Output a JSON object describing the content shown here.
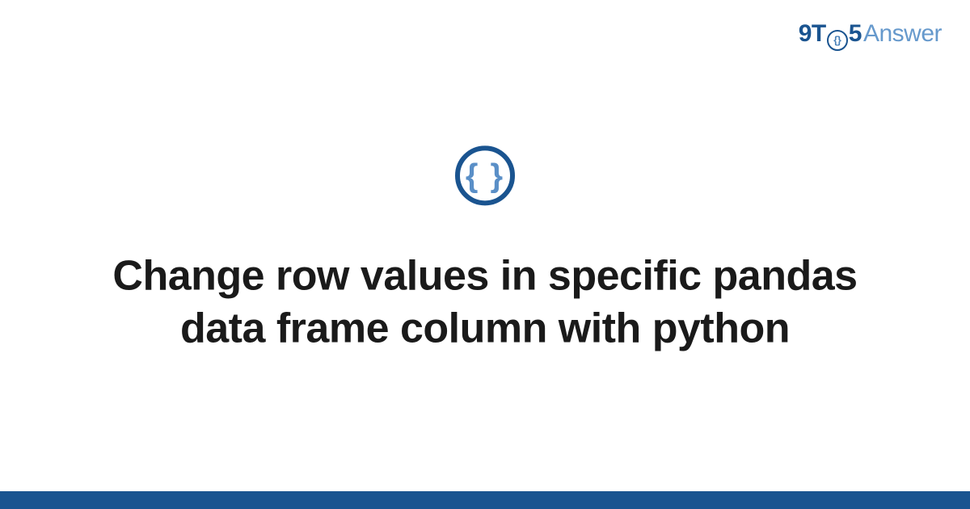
{
  "header": {
    "logo": {
      "part1": "9T",
      "zero_inner": "{}",
      "part2": "5",
      "part3": "Answer"
    }
  },
  "main": {
    "icon_glyph": "{ }",
    "title": "Change row values in specific pandas data frame column with python"
  },
  "colors": {
    "brand_dark": "#1a5490",
    "brand_light": "#6699cc",
    "text": "#1a1a1a"
  }
}
